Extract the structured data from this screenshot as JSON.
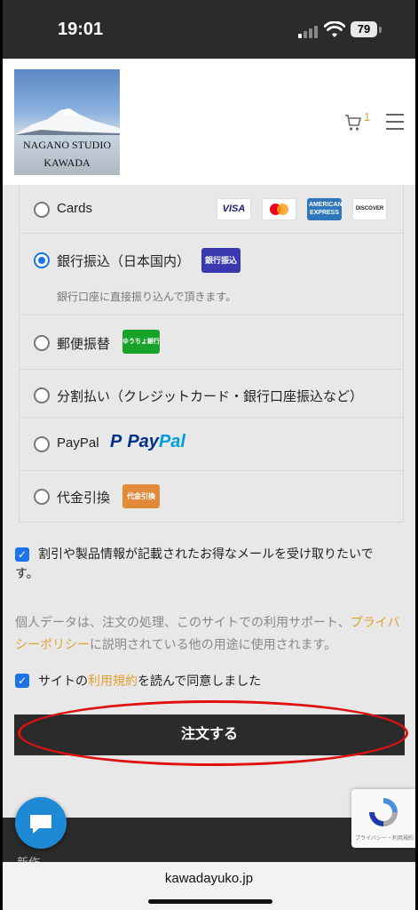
{
  "status_bar": {
    "time": "19:01",
    "battery": "79"
  },
  "brand": {
    "line1": "NAGANO STUDIO",
    "line2": "KAWADA"
  },
  "cart": {
    "count": "1"
  },
  "payment_methods": [
    {
      "label": "Cards"
    },
    {
      "label": "銀行振込（日本国内）",
      "badge": "銀行振込",
      "description": "銀行口座に直接振り込んで頂きます。",
      "selected": true
    },
    {
      "label": "郵便振替",
      "badge": "ゆうちょ銀行"
    },
    {
      "label": "分割払い（クレジットカード・銀行口座振込など）"
    },
    {
      "label": "PayPal",
      "logo_text_1": "Pay",
      "logo_text_2": "Pal"
    },
    {
      "label": "代金引換",
      "badge": "代金引換"
    }
  ],
  "card_logos": {
    "visa": "VISA",
    "amex": "AMERICAN EXPRESS",
    "discover": "DISCOVER"
  },
  "newsletter": {
    "label_line1": "割引や製品情報が記載されたお得なメールを受け取りたいで",
    "label_line2": "す。",
    "checked": true
  },
  "privacy": {
    "text_before": "個人データは、注文の処理、このサイトでの利用サポート、",
    "link": "プライバシーポリシー",
    "text_after": "に説明されている他の用途に使用されます。"
  },
  "terms": {
    "before": "サイトの",
    "link": "利用規約",
    "after": "を読んで同意しました",
    "checked": true
  },
  "order_button": {
    "label": "注文する"
  },
  "footer": {
    "partial_text": "新作"
  },
  "recaptcha": {
    "text": "プライバシー・利用規約"
  },
  "browser": {
    "url": "kawadayuko.jp"
  },
  "colors": {
    "accent_link": "#e0a030",
    "selected_blue": "#1a73e8",
    "highlight_red": "#e01010"
  }
}
